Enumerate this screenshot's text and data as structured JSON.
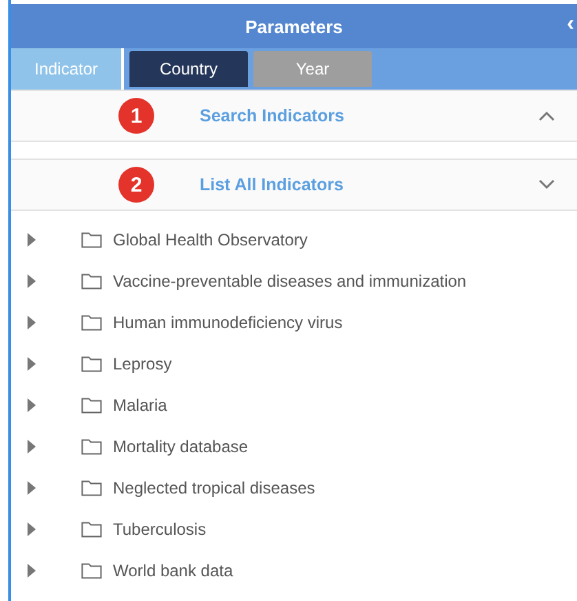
{
  "panel": {
    "title": "Parameters",
    "collapse_glyph": "‹"
  },
  "tabs": [
    {
      "label": "Indicator",
      "selected": true,
      "color": "#8fc3ea"
    },
    {
      "label": "Country",
      "selected": false,
      "color": "#243659"
    },
    {
      "label": "Year",
      "selected": false,
      "color": "#9e9e9e"
    }
  ],
  "sections": [
    {
      "badge": "1",
      "title": "Search Indicators",
      "expanded": true
    },
    {
      "badge": "2",
      "title": "List All Indicators",
      "expanded": false
    }
  ],
  "tree": [
    {
      "label": "Global Health Observatory",
      "expanded": false
    },
    {
      "label": "Vaccine-preventable diseases and immunization",
      "expanded": false
    },
    {
      "label": "Human immunodeficiency virus",
      "expanded": false
    },
    {
      "label": "Leprosy",
      "expanded": false
    },
    {
      "label": "Malaria",
      "expanded": false
    },
    {
      "label": "Mortality database",
      "expanded": false
    },
    {
      "label": "Neglected tropical diseases",
      "expanded": false
    },
    {
      "label": "Tuberculosis",
      "expanded": false
    },
    {
      "label": "World bank data",
      "expanded": false
    }
  ]
}
